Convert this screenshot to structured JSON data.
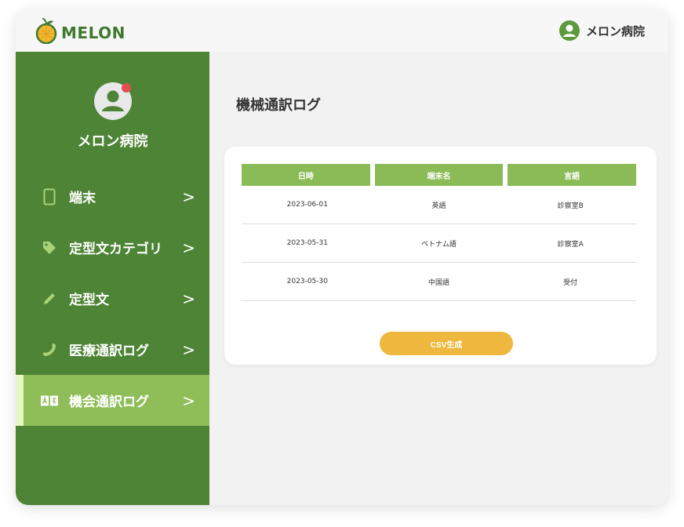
{
  "header": {
    "logo_text": "MELON",
    "user_name": "メロン病院"
  },
  "sidebar": {
    "profile_name": "メロン病院",
    "items": [
      {
        "label": "端末",
        "icon": "tablet-icon",
        "active": false
      },
      {
        "label": "定型文カテゴリ",
        "icon": "tag-icon",
        "active": false
      },
      {
        "label": "定型文",
        "icon": "pencil-icon",
        "active": false
      },
      {
        "label": "医療通訳ログ",
        "icon": "phone-icon",
        "active": false
      },
      {
        "label": "機会通訳ログ",
        "icon": "translate-icon",
        "active": true
      }
    ],
    "chevron": ">"
  },
  "main": {
    "page_title": "機械通訳ログ",
    "table": {
      "columns": [
        "日時",
        "端末名",
        "言語"
      ],
      "rows": [
        [
          "2023-06-01",
          "英語",
          "診察室B"
        ],
        [
          "2023-05-31",
          "ベトナム語",
          "診察室A"
        ],
        [
          "2023-05-30",
          "中国語",
          "受付"
        ]
      ]
    },
    "csv_button": "CSV生成"
  },
  "colors": {
    "sidebar_bg": "#4e8436",
    "active_item": "#8fbe58",
    "table_header": "#8bbb56",
    "csv_button": "#eeb73d",
    "notification_dot": "#e05050"
  }
}
